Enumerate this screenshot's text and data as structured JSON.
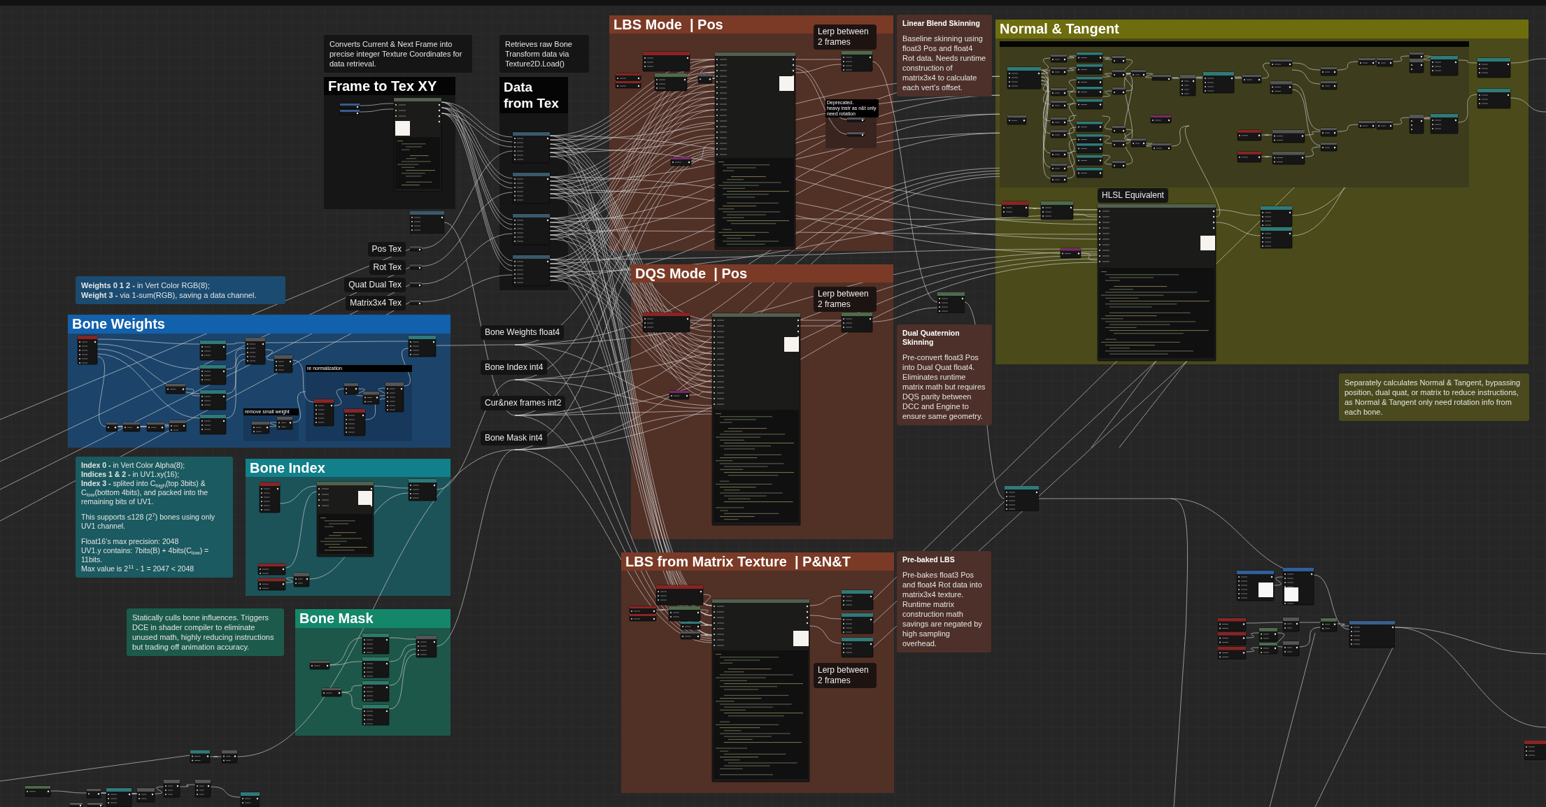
{
  "graph": {
    "groups": [
      {
        "title": "Frame to Tex XY",
        "color": "#050505"
      },
      {
        "title": "Data from Tex",
        "color": "#050505"
      },
      {
        "title": "LBS Mode  | Pos",
        "color": "#7b3a26",
        "notes": [
          {
            "text": "Deprecated.\nheavy instr as n&t only need rotation"
          }
        ]
      },
      {
        "title": "Normal & Tangent",
        "color": "#6d6d0e"
      },
      {
        "title": "Bone Weights",
        "color": "#1261ad",
        "notes": [
          {
            "text": "re normalization"
          },
          {
            "text": "remove small weight"
          }
        ]
      },
      {
        "title": "DQS Mode  | Pos",
        "color": "#7b3a26"
      },
      {
        "title": "Bone Index",
        "color": "#11808a"
      },
      {
        "title": "Bone Mask",
        "color": "#14876b"
      },
      {
        "title": "LBS from Matrix Texture  | P&N&T",
        "color": "#7b3a26"
      }
    ],
    "comments": [
      {
        "kind": "note",
        "color": "#151515",
        "paragraphs": [
          "Converts Current & Next Frame into precise integer Texture Coordinates for data retrieval."
        ]
      },
      {
        "kind": "note",
        "color": "#151515",
        "paragraphs": [
          "Retrieves raw Bone Transform data via Texture2D.Load()"
        ]
      },
      {
        "kind": "tag",
        "color": "#1d1412",
        "text": "Lerp between 2 frames"
      },
      {
        "kind": "titled",
        "color": "#4d3029",
        "title": "Linear Blend Skinning",
        "paragraphs": [
          "Baseline skinning using float3 Pos and float4 Rot data. Needs runtime construction of matrix3x4 to calculate each vert’s offset."
        ]
      },
      {
        "kind": "tag",
        "color": "#151515",
        "text": "HLSL Equivalent"
      },
      {
        "kind": "tag",
        "color": "#141414",
        "text": "Pos Tex"
      },
      {
        "kind": "tag",
        "color": "#141414",
        "text": "Rot Tex"
      },
      {
        "kind": "tag",
        "color": "#141414",
        "text": "Quat Dual Tex"
      },
      {
        "kind": "tag",
        "color": "#141414",
        "text": "Matrix3x4 Tex"
      },
      {
        "kind": "note",
        "color": "#1b4b70",
        "paragraphs": [
          "**Weights 0 1 2 -** in Vert Color RGB(8);\n**Weight 3 -** via 1-sum(RGB), saving a data channel."
        ]
      },
      {
        "kind": "tag",
        "color": "#141414",
        "text": "Bone Weights float4"
      },
      {
        "kind": "tag",
        "color": "#141414",
        "text": "Bone Index int4"
      },
      {
        "kind": "tag",
        "color": "#141414",
        "text": "Cur&nex frames int2"
      },
      {
        "kind": "tag",
        "color": "#141414",
        "text": "Bone Mask int4"
      },
      {
        "kind": "tag",
        "color": "#1d1412",
        "text": "Lerp between 2 frames"
      },
      {
        "kind": "titled",
        "color": "#4d3029",
        "title": "Dual Quaternion Skinning",
        "paragraphs": [
          "Pre-convert float3 Pos into Dual Quat float4. Eliminates runtime matrix math but requires DQS parity between DCC and Engine to ensure same geometry."
        ]
      },
      {
        "kind": "note",
        "color": "#4a4a1e",
        "paragraphs": [
          "Separately calculates Normal & Tangent, bypassing position, dual quat, or matrix to reduce instructions, as Normal & Tangent only need rotation info from each bone."
        ]
      },
      {
        "kind": "note",
        "color": "#1a5a60",
        "paragraphs": [
          "**Index 0 -** in Vert Color Alpha(8);\n**Indices 1 & 2 -** in UV1.xy(16);\n**Index 3 -** splited into C$_{high}$(top 3bits) & C$_{low}$(bottom 4bits), and packed into the remaining bits of UV1.",
          "This supports ≤128 (2$^{7}$) bones using only UV1 channel.",
          "Float16’s max precision: 2048\nUV1.y contains: 7bits(B) + 4bits(C$_{low}$) = 11bits.\nMax value is 2$^{11}$ - 1 = 2047 < 2048"
        ]
      },
      {
        "kind": "note",
        "color": "#1c5b4b",
        "paragraphs": [
          "Statically culls bone influences. Triggers DCE in shader compiler to eliminate unused math, highly reducing instructions but trading off animation accuracy."
        ]
      },
      {
        "kind": "titled",
        "color": "#4d3029",
        "title": "Pre-baked LBS",
        "paragraphs": [
          "Pre-bakes float3 Pos and float4 Rot data into matrix3x4 texture. Runtime matrix construction math savings are negated by high sampling overhead."
        ]
      },
      {
        "kind": "tag",
        "color": "#1d1412",
        "text": "Lerp between 2 frames"
      }
    ]
  }
}
